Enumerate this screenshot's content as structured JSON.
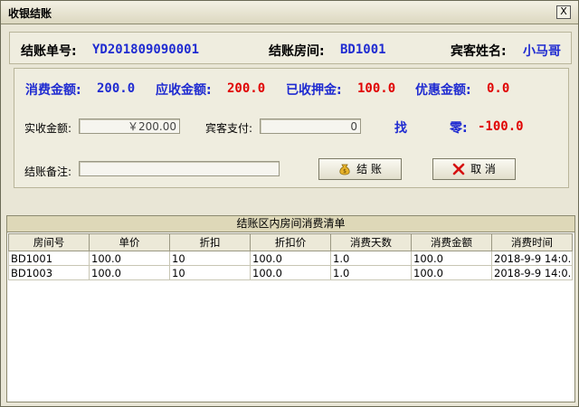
{
  "window": {
    "title": "收银结账",
    "close_symbol": "X"
  },
  "header": {
    "order_no_label": "结账单号:",
    "order_no_value": "YD201809090001",
    "room_label": "结账房间:",
    "room_value": "BD1001",
    "guest_label": "宾客姓名:",
    "guest_value": "小马哥"
  },
  "summary": {
    "consume_label": "消费金额:",
    "consume_value": "200.0",
    "receivable_label": "应收金额:",
    "receivable_value": "200.0",
    "deposit_label": "已收押金:",
    "deposit_value": "100.0",
    "discount_label": "优惠金额:",
    "discount_value": "0.0"
  },
  "payment": {
    "actual_label": "实收金额:",
    "actual_value": "￥200.00",
    "guest_pay_label": "宾客支付:",
    "guest_pay_value": "0",
    "change_label_1": "找",
    "change_label_2": "零:",
    "change_value": "-100.0",
    "remark_label": "结账备注:",
    "remark_value": ""
  },
  "buttons": {
    "checkout": "结 账",
    "cancel": "取 消"
  },
  "grid": {
    "caption": "结账区内房间消费清单",
    "columns": [
      "房间号",
      "单价",
      "折扣",
      "折扣价",
      "消费天数",
      "消费金额",
      "消费时间"
    ],
    "rows": [
      [
        "BD1001",
        "100.0",
        "10",
        "100.0",
        "1.0",
        "100.0",
        "2018-9-9 14:0..."
      ],
      [
        "BD1003",
        "100.0",
        "10",
        "100.0",
        "1.0",
        "100.0",
        "2018-9-9 14:0..."
      ]
    ]
  },
  "colors": {
    "blue_text": "#1f2bd1",
    "red_text": "#e00000",
    "background": "#e9e6d6"
  },
  "icons": {
    "checkout": "money-bag-icon",
    "cancel": "red-x-icon"
  }
}
